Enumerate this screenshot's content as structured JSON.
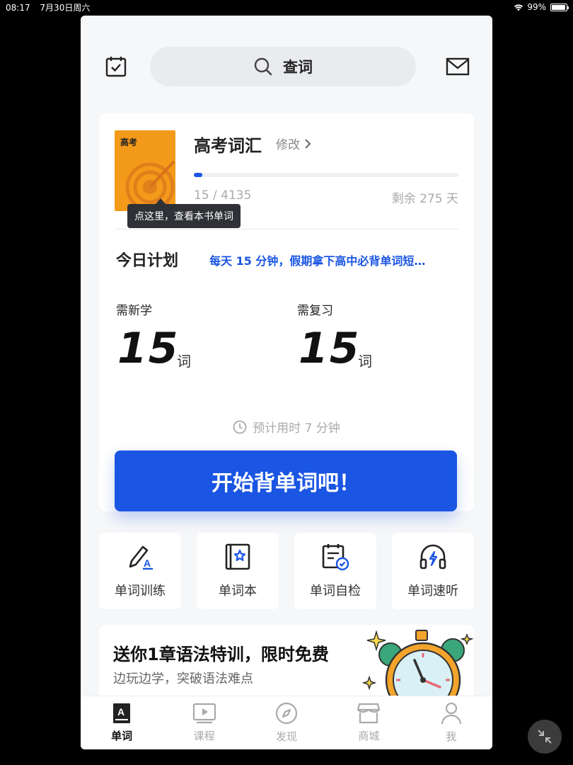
{
  "status": {
    "time": "08:17",
    "date": "7月30日周六",
    "battery": "99%"
  },
  "search": {
    "label": "查词"
  },
  "book": {
    "tag": "高考",
    "title": "高考词汇",
    "edit_label": "修改",
    "progress_text": "15 / 4135",
    "progress_fraction": 0.0036,
    "remaining": "剩余 275 天",
    "tooltip": "点这里，查看本书单词"
  },
  "plan": {
    "label": "今日计划",
    "description": "每天 15 分钟，假期拿下高中必背单词短…"
  },
  "stats": {
    "new": {
      "label": "需新学",
      "value": "15",
      "unit": "词"
    },
    "review": {
      "label": "需复习",
      "value": "15",
      "unit": "词"
    }
  },
  "estimate": "预计用时 7 分钟",
  "start_button": "开始背单词吧！",
  "tools": [
    {
      "label": "单词训练",
      "icon": "pen-a-icon"
    },
    {
      "label": "单词本",
      "icon": "star-book-icon"
    },
    {
      "label": "单词自检",
      "icon": "calendar-check-icon"
    },
    {
      "label": "单词速听",
      "icon": "headphones-icon"
    }
  ],
  "promo": {
    "title": "送你1章语法特训，限时免费",
    "subtitle": "边玩边学，突破语法难点"
  },
  "tabs": [
    {
      "label": "单词",
      "icon": "word-book-icon",
      "active": true
    },
    {
      "label": "课程",
      "icon": "video-icon",
      "active": false
    },
    {
      "label": "发现",
      "icon": "compass-icon",
      "active": false
    },
    {
      "label": "商城",
      "icon": "store-icon",
      "active": false
    },
    {
      "label": "我",
      "icon": "person-icon",
      "active": false
    }
  ],
  "colors": {
    "accent": "#1a55e3",
    "book": "#f39a1a"
  }
}
